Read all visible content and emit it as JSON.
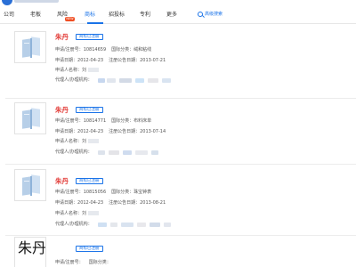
{
  "tabs": [
    {
      "label": "公司"
    },
    {
      "label": "老板"
    },
    {
      "label": "风险"
    },
    {
      "label": "商标"
    },
    {
      "label": "招投标"
    },
    {
      "label": "专利"
    },
    {
      "label": "更多"
    }
  ],
  "tab_badge": "NEW",
  "active_tab": "商标",
  "advanced_search": "高级搜索",
  "cards": [
    {
      "name": "朱丹",
      "status": "商标已注册",
      "reg_no_label": "申请/注册号：",
      "reg_no": "10814659",
      "intl_class_label": "国际分类：",
      "intl_class": "绒和粘线",
      "apply_date_label": "申请日期：",
      "apply_date": "2012-04-23",
      "announce_label": "注册公告日期：",
      "announce_date": "2013-07-21",
      "applicant_label": "申请人名称：",
      "applicant": "刘",
      "agent_label": "代理人/办理机构："
    },
    {
      "name": "朱丹",
      "status": "商标已注册",
      "reg_no_label": "申请/注册号：",
      "reg_no": "10814771",
      "intl_class_label": "国际分类：",
      "intl_class": "布料床单",
      "apply_date_label": "申请日期：",
      "apply_date": "2012-04-23",
      "announce_label": "注册公告日期：",
      "announce_date": "2013-07-14",
      "applicant_label": "申请人名称：",
      "applicant": "刘",
      "agent_label": "代理人/办理机构："
    },
    {
      "name": "朱丹",
      "status": "商标已注册",
      "reg_no_label": "申请/注册号：",
      "reg_no": "10815056",
      "intl_class_label": "国际分类：",
      "intl_class": "珠宝钟表",
      "apply_date_label": "申请日期：",
      "apply_date": "2012-04-23",
      "announce_label": "注册公告日期：",
      "announce_date": "2013-08-21",
      "applicant_label": "申请人名称：",
      "applicant": "刘",
      "agent_label": "代理人/办理机构："
    },
    {
      "name": "",
      "status": "商标已注册",
      "reg_no_label": "申请/注册号：",
      "reg_no": "",
      "intl_class_label": "国际分类：",
      "intl_class": "",
      "thumb_text": "朱丹"
    }
  ],
  "colors": {
    "accent": "#1a73e8",
    "name_red": "#e3413d",
    "badge_red": "#f04e23"
  }
}
